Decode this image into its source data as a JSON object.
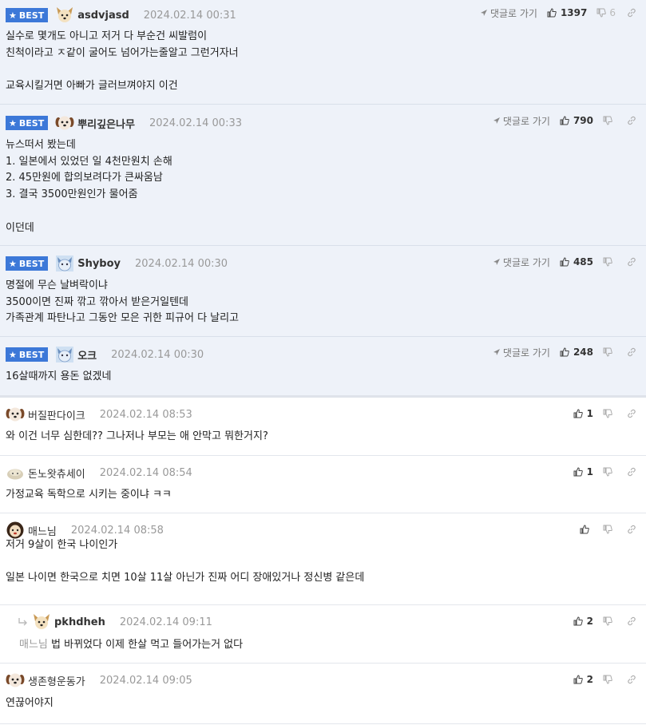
{
  "ui": {
    "best_label": "BEST",
    "reply_label": "댓글로 가기"
  },
  "comments": [
    {
      "best": true,
      "nick": "asdvjasd",
      "avatar": "dog-avatar",
      "date": "2024.02.14 00:31",
      "likes": "1397",
      "dislikes": "6",
      "body": "실수로 몇개도 아니고 저거 다 부순건 씨발럼이\n친척이라고 ㅈ같이 굴어도 넘어가는줄알고 그런거자너\n\n교육시킬거면 아빠가 글러브껴야지 이건"
    },
    {
      "best": true,
      "nick": "뿌리깊은나무",
      "avatar": "puppy-avatar",
      "date": "2024.02.14 00:33",
      "likes": "790",
      "dislikes": "",
      "body": "뉴스떠서 봤는데\n1. 일본에서 있었던 일 4천만원치 손해\n2. 45만원에 합의보려다가 큰싸움남\n3. 결국 3500만원인가 물어줌\n\n이던데"
    },
    {
      "best": true,
      "nick": "Shyboy",
      "avatar": "blue-cat-avatar",
      "date": "2024.02.14 00:30",
      "likes": "485",
      "dislikes": "",
      "body": "명절에 무슨 날벼락이냐\n3500이면 진짜 깎고 깎아서 받은거일텐데\n가족관계 파탄나고 그동안 모은 귀한 피규어 다 날리고"
    },
    {
      "best": true,
      "nick": "오크",
      "avatar": "blue-cat-avatar",
      "date": "2024.02.14 00:30",
      "likes": "248",
      "dislikes": "",
      "body": "16살때까지 용돈 없겠네"
    },
    {
      "best": false,
      "nick": "버질판다이크",
      "avatar": "puppy-avatar",
      "date": "2024.02.14 08:53",
      "likes": "1",
      "dislikes": "",
      "body": "와 이건 너무 심한데?? 그나저나 부모는 애 안막고 뭐한거지?"
    },
    {
      "best": false,
      "nick": "돈노왓츄세이",
      "avatar": "blob-avatar",
      "date": "2024.02.14 08:54",
      "likes": "1",
      "dislikes": "",
      "body": "가정교육 독학으로 시키는 중이냐 ㅋㅋ"
    },
    {
      "best": false,
      "nick": "매느님",
      "avatar": "lion-avatar",
      "date": "2024.02.14 08:58",
      "likes": "",
      "dislikes": "",
      "body": "저거 9살이 한국 나이인가\n\n일본 나이면 한국으로 치면 10살 11살 아닌가 진짜 어디 장애있거나 정신병 같은데"
    },
    {
      "best": false,
      "reply": true,
      "nick": "pkhdheh",
      "avatar": "dog-avatar",
      "date": "2024.02.14 09:11",
      "likes": "2",
      "dislikes": "",
      "mention": "매느님",
      "body": " 법 바뀌었다 이제 한살 먹고 들어가는거 없다"
    },
    {
      "best": false,
      "nick": "생존형운동가",
      "avatar": "puppy-avatar",
      "date": "2024.02.14 09:05",
      "likes": "2",
      "dislikes": "",
      "body": "연끊어야지"
    }
  ]
}
